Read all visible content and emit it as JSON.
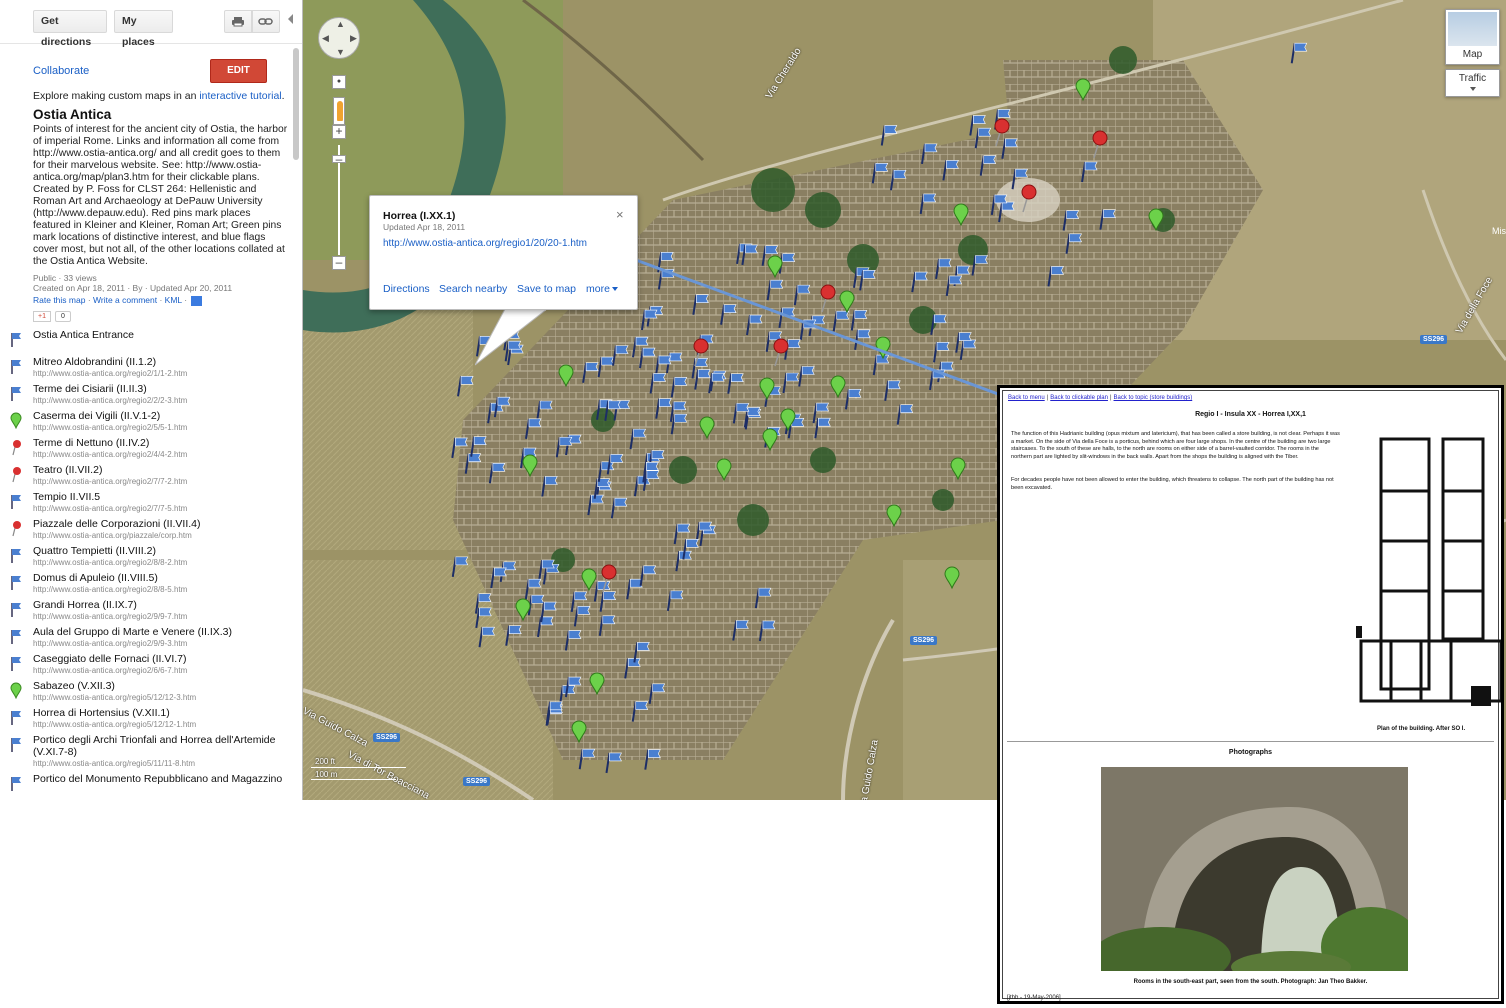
{
  "toolbar": {
    "get_directions": "Get directions",
    "my_places": "My places",
    "print_icon": "printer-icon",
    "link_icon": "link-icon"
  },
  "sidebar": {
    "collaborate": "Collaborate",
    "edit": "EDIT",
    "explore_prefix": "Explore making custom maps in an",
    "explore_link": "interactive tutorial",
    "explore_suffix": ".",
    "title": "Ostia Antica",
    "description": "Points of interest for the ancient city of Ostia, the harbor of imperial Rome. Links and information all come from http://www.ostia-antica.org/ and all credit goes to them for their marvelous website. See: http://www.ostia-antica.org/map/plan3.htm for their clickable plans. Created by P. Foss for CLST 264: Hellenistic and Roman Art and Archaeology at DePauw University (http://www.depauw.edu). Red pins mark places featured in Kleiner and Kleiner, Roman Art; Green pins mark locations of distinctive interest, and blue flags cover most, but not all, of the other locations collated at the Ostia Antica Website.",
    "public_views": "Public · 33 views",
    "created": "Created on Apr 18, 2011 · By  · Updated Apr 20, 2011",
    "rate": "Rate this map",
    "write_comment": "Write a comment",
    "kml": "KML",
    "sep": " · ",
    "plus_one": "+1",
    "plus_count": "0",
    "places": [
      {
        "name": "Ostia Antica Entrance",
        "url": "",
        "icon": "blue-flag"
      },
      {
        "name": "Mitreo Aldobrandini (II.1.2)",
        "url": "http://www.ostia-antica.org/regio2/1/1-2.htm",
        "icon": "blue-flag"
      },
      {
        "name": "Terme dei Cisiarii (II.II.3)",
        "url": "http://www.ostia-antica.org/regio2/2/2-3.htm",
        "icon": "blue-flag"
      },
      {
        "name": "Caserma dei Vigili (II.V.1-2)",
        "url": "http://www.ostia-antica.org/regio2/5/5-1.htm",
        "icon": "green-pin"
      },
      {
        "name": "Terme di Nettuno (II.IV.2)",
        "url": "http://www.ostia-antica.org/regio2/4/4-2.htm",
        "icon": "red-pushpin"
      },
      {
        "name": "Teatro (II.VII.2)",
        "url": "http://www.ostia-antica.org/regio2/7/7-2.htm",
        "icon": "red-pushpin"
      },
      {
        "name": "Tempio II.VII.5",
        "url": "http://www.ostia-antica.org/regio2/7/7-5.htm",
        "icon": "blue-flag"
      },
      {
        "name": "Piazzale delle Corporazioni (II.VII.4)",
        "url": "http://www.ostia-antica.org/piazzale/corp.htm",
        "icon": "red-pushpin"
      },
      {
        "name": "Quattro Tempietti (II.VIII.2)",
        "url": "http://www.ostia-antica.org/regio2/8/8-2.htm",
        "icon": "blue-flag"
      },
      {
        "name": "Domus di Apuleio (II.VIII.5)",
        "url": "http://www.ostia-antica.org/regio2/8/8-5.htm",
        "icon": "blue-flag"
      },
      {
        "name": "Grandi Horrea (II.IX.7)",
        "url": "http://www.ostia-antica.org/regio2/9/9-7.htm",
        "icon": "blue-flag"
      },
      {
        "name": "Aula del Gruppo di Marte e Venere (II.IX.3)",
        "url": "http://www.ostia-antica.org/regio2/9/9-3.htm",
        "icon": "blue-flag"
      },
      {
        "name": "Caseggiato delle Fornaci (II.VI.7)",
        "url": "http://www.ostia-antica.org/regio2/6/6-7.htm",
        "icon": "blue-flag"
      },
      {
        "name": "Sabazeo (V.XII.3)",
        "url": "http://www.ostia-antica.org/regio5/12/12-3.htm",
        "icon": "green-pin"
      },
      {
        "name": "Horrea di Hortensius (V.XII.1)",
        "url": "http://www.ostia-antica.org/regio5/12/12-1.htm",
        "icon": "blue-flag"
      },
      {
        "name": "Portico degli Archi Trionfali and Horrea dell'Artemide (V.XI.7-8)",
        "url": "http://www.ostia-antica.org/regio5/11/11-8.htm",
        "icon": "blue-flag"
      },
      {
        "name": "Portico del Monumento Repubblicano and Magazzino",
        "url": "",
        "icon": "blue-flag"
      }
    ]
  },
  "map": {
    "map_type": "Map",
    "traffic": "Traffic",
    "edge_label": "Mis",
    "road_labels": [
      "Via Cheraldo",
      "Via della Foce",
      "Via Guido Calza",
      "Via Guido Calza",
      "Via di Tor Boacciana"
    ],
    "shields": [
      "SS296",
      "SS296",
      "SS296",
      "SS296"
    ],
    "scale_ft": "200 ft",
    "scale_m": "100 m",
    "colors": {
      "blue_flag": "#4a7fd0",
      "green_pin": "#6cd14a",
      "red_pin": "#d93030",
      "link": "#1a5fc6",
      "edit": "#d14836"
    }
  },
  "info_window": {
    "title": "Horrea (I.XX.1)",
    "updated": "Updated Apr 18, 2011",
    "url": "http://www.ostia-antica.org/regio1/20/20-1.htm",
    "close": "×",
    "actions": {
      "directions": "Directions",
      "search_nearby": "Search nearby",
      "save_to_map": "Save to map",
      "more": "more"
    }
  },
  "overlay_page": {
    "nav": {
      "back_menu": "Back to menu",
      "back_plan": "Back to clickable plan",
      "back_topic": "Back to topic (store buildings)",
      "sep": "|"
    },
    "title": "Regio I - Insula XX - Horrea I,XX,1",
    "p1": "The function of this Hadrianic building (opus mixtum and latericium), that has been called a store building, is not clear. Perhaps it was a market. On the side of Via della Foce is a porticus, behind which are four large shops. In the centre of the building are two large staircases. To the south of these are halls, to the north are rooms on either side of a barrel-vaulted corridor. The rooms in the northern part are lighted by slit-windows in the back walls. Apart from the shops the building is aligned with the Tiber.",
    "p2": "For decades people have not been allowed to enter the building, which threatens to collapse. The north part of the building has not been excavated.",
    "plan_caption": "Plan of the building. After SO I.",
    "photos_heading": "Photographs",
    "photo_caption": "Rooms in the south-east part, seen from the south. Photograph: Jan Theo Bakker.",
    "footer": "[jthb - 19-May-2006]"
  }
}
